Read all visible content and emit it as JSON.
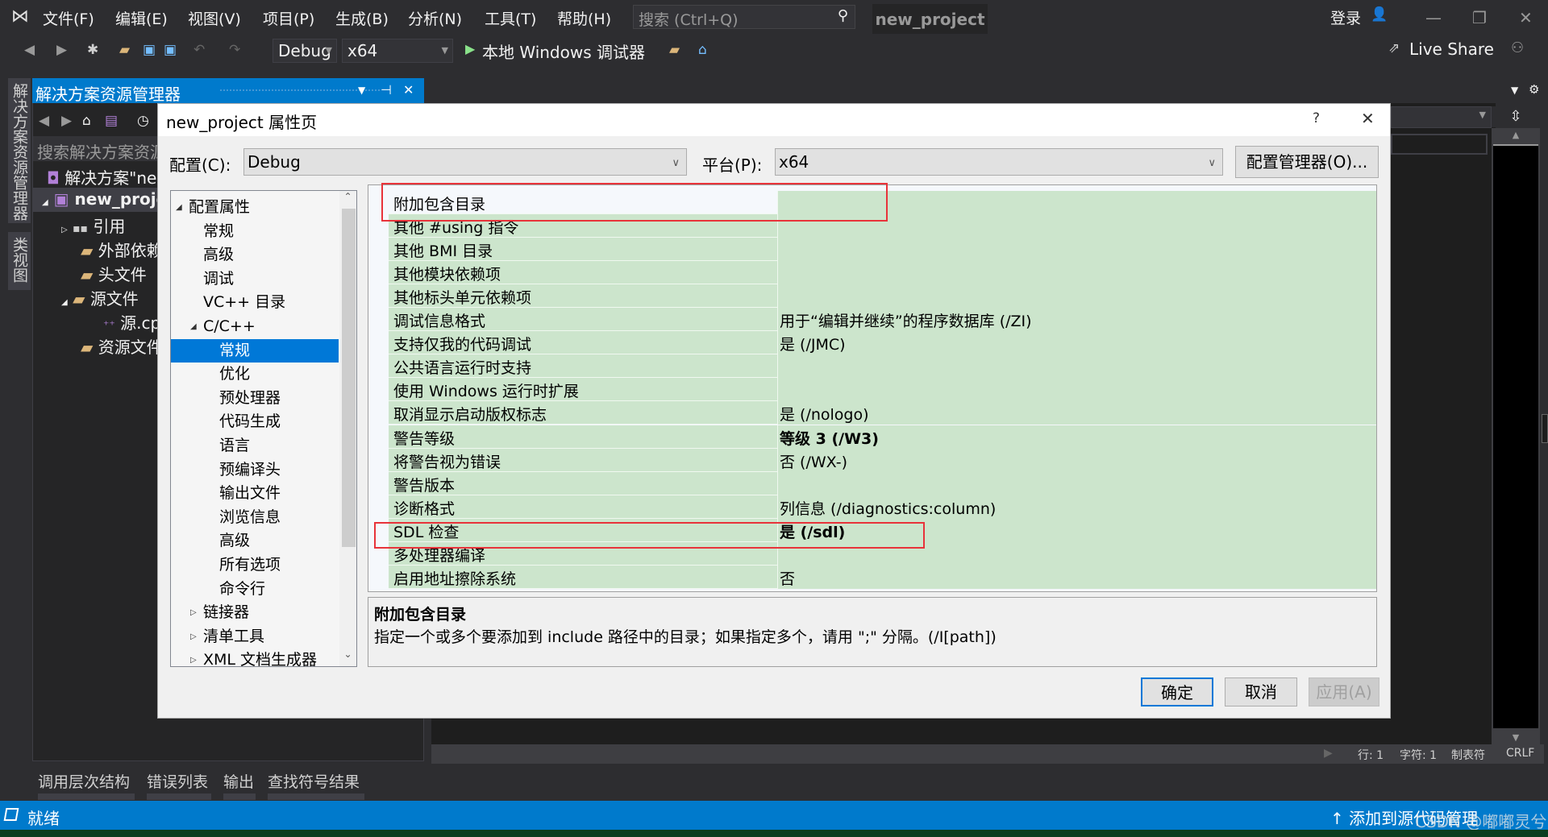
{
  "menu": {
    "items": [
      "文件(F)",
      "编辑(E)",
      "视图(V)",
      "项目(P)",
      "生成(B)",
      "分析(N)",
      "工具(T)",
      "帮助(H)"
    ],
    "search_placeholder": "搜索 (Ctrl+Q)",
    "project_title": "new_project",
    "sign_in": "登录"
  },
  "toolbar": {
    "config": "Debug",
    "platform": "x64",
    "run_label": "本地 Windows 调试器",
    "live_share": "Live Share"
  },
  "left_tabs": [
    "解决方案资源管理器",
    "类视图"
  ],
  "solution_explorer": {
    "title": "解决方案资源管理器",
    "search_placeholder": "搜索解决方案资源管",
    "nodes": [
      {
        "label": "解决方案\"new_project\"",
        "icon": "solution-icon"
      },
      {
        "label": "new_project",
        "icon": "project-icon",
        "expanded": true,
        "bold": true
      },
      {
        "label": "引用",
        "icon": "references-icon"
      },
      {
        "label": "外部依赖项",
        "icon": "external-deps-icon"
      },
      {
        "label": "头文件",
        "icon": "folder-filter-icon"
      },
      {
        "label": "源文件",
        "icon": "folder-filter-icon",
        "expanded": true
      },
      {
        "label": "源.cpp",
        "icon": "cpp-file-icon"
      },
      {
        "label": "资源文件",
        "icon": "folder-filter-icon"
      }
    ]
  },
  "bottom_tabs": [
    "调用层次结构",
    "错误列表",
    "输出",
    "查找符号结果"
  ],
  "editor_status": {
    "line": "行: 1",
    "char": "字符: 1",
    "tabs": "制表符",
    "eol": "CRLF"
  },
  "statusbar": {
    "ready": "就绪",
    "source_control": "添加到源代码管理",
    "watermark": "CSDN @嘟嘟灵兮"
  },
  "dialog": {
    "title": "new_project 属性页",
    "help": "?",
    "close": "✕",
    "config_label": "配置(C):",
    "config_value": "Debug",
    "platform_label": "平台(P):",
    "platform_value": "x64",
    "config_manager": "配置管理器(O)...",
    "tree": [
      {
        "label": "配置属性",
        "level": 0,
        "expander": "expanded"
      },
      {
        "label": "常规",
        "level": 1
      },
      {
        "label": "高级",
        "level": 1
      },
      {
        "label": "调试",
        "level": 1
      },
      {
        "label": "VC++ 目录",
        "level": 1
      },
      {
        "label": "C/C++",
        "level": 1,
        "expander": "expanded"
      },
      {
        "label": "常规",
        "level": 2,
        "selected": true
      },
      {
        "label": "优化",
        "level": 2
      },
      {
        "label": "预处理器",
        "level": 2
      },
      {
        "label": "代码生成",
        "level": 2
      },
      {
        "label": "语言",
        "level": 2
      },
      {
        "label": "预编译头",
        "level": 2
      },
      {
        "label": "输出文件",
        "level": 2
      },
      {
        "label": "浏览信息",
        "level": 2
      },
      {
        "label": "高级",
        "level": 2
      },
      {
        "label": "所有选项",
        "level": 2
      },
      {
        "label": "命令行",
        "level": 2
      },
      {
        "label": "链接器",
        "level": 1,
        "expander": "collapsed"
      },
      {
        "label": "清单工具",
        "level": 1,
        "expander": "collapsed"
      },
      {
        "label": "XML 文档生成器",
        "level": 1,
        "expander": "collapsed"
      }
    ],
    "properties": [
      {
        "name": "附加包含目录",
        "value": "",
        "bold": false
      },
      {
        "name": "其他 #using 指令",
        "value": "",
        "bold": false
      },
      {
        "name": "其他 BMI 目录",
        "value": "",
        "bold": false
      },
      {
        "name": "其他模块依赖项",
        "value": "",
        "bold": false
      },
      {
        "name": "其他标头单元依赖项",
        "value": "",
        "bold": false
      },
      {
        "name": "调试信息格式",
        "value": "用于“编辑并继续”的程序数据库 (/ZI)",
        "bold": false
      },
      {
        "name": "支持仅我的代码调试",
        "value": "是 (/JMC)",
        "bold": false
      },
      {
        "name": "公共语言运行时支持",
        "value": "",
        "bold": false
      },
      {
        "name": "使用 Windows 运行时扩展",
        "value": "",
        "bold": false
      },
      {
        "name": "取消显示启动版权标志",
        "value": "是 (/nologo)",
        "bold": false
      },
      {
        "name": "警告等级",
        "value": "等级 3 (/W3)",
        "bold": true
      },
      {
        "name": "将警告视为错误",
        "value": "否 (/WX-)",
        "bold": false
      },
      {
        "name": "警告版本",
        "value": "",
        "bold": false
      },
      {
        "name": "诊断格式",
        "value": "列信息 (/diagnostics:column)",
        "bold": false
      },
      {
        "name": "SDL 检查",
        "value": "是 (/sdl)",
        "bold": true
      },
      {
        "name": "多处理器编译",
        "value": "",
        "bold": false
      },
      {
        "name": "启用地址擦除系统",
        "value": "否",
        "bold": false
      }
    ],
    "highlighted_properties": [
      "附加包含目录",
      "SDL 检查"
    ],
    "description": {
      "title": "附加包含目录",
      "text": "指定一个或多个要添加到 include 路径中的目录；如果指定多个，请用 \";\" 分隔。(/I[path])"
    },
    "buttons": {
      "ok": "确定",
      "cancel": "取消",
      "apply": "应用(A)"
    }
  },
  "colors": {
    "accent": "#007acc",
    "grid_row": "#cce5cc",
    "highlight": "#e8333a",
    "selection": "#0078d7"
  }
}
